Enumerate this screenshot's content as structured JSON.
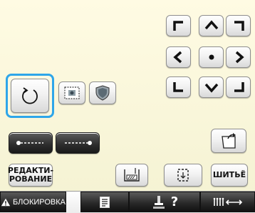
{
  "accent_color": "#2ea6e9",
  "direction_pad": {
    "up_left": "corner-up-left-icon",
    "up": "arrow-up-icon",
    "up_right": "corner-up-right-icon",
    "left": "arrow-left-icon",
    "center": "center-dot-icon",
    "right": "arrow-right-icon",
    "down_left": "corner-down-left-icon",
    "down": "arrow-down-icon",
    "down_right": "corner-down-right-icon"
  },
  "tools": {
    "rotate_icon": "rotate-icon",
    "scan_icon": "embroidery-frame-icon",
    "shield_icon": "shield-design-icon"
  },
  "buttons": {
    "edit_label_line1": "РЕДАКТИ-",
    "edit_label_line2": "РОВАНИЕ",
    "sew_label": "ШИТЬЁ"
  },
  "bottom_bar": {
    "lock_label": "БЛОКИРОВКА",
    "help_symbol": "?"
  }
}
